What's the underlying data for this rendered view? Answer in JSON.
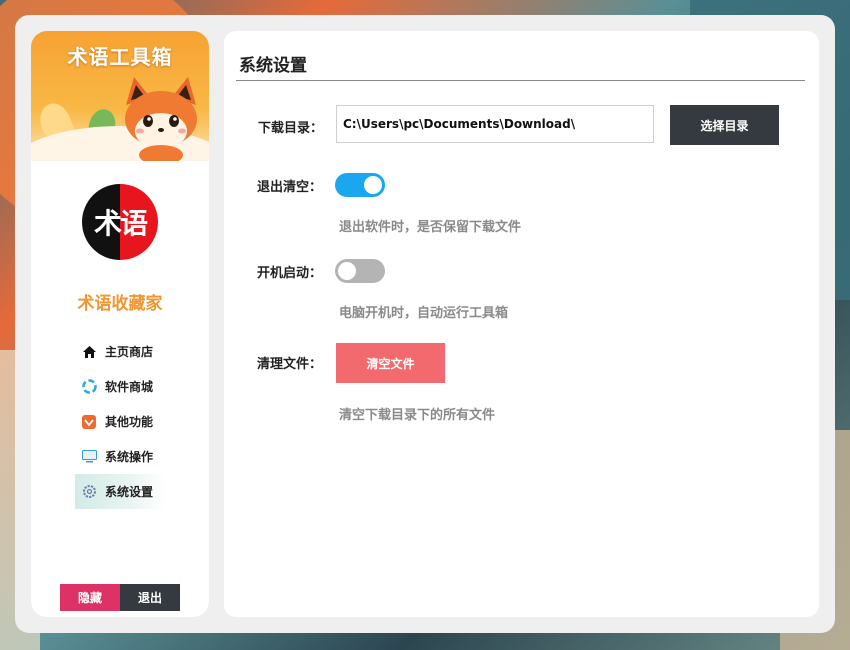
{
  "sidebar": {
    "banner_title": "术语工具箱",
    "logo_text": "术语",
    "app_name": "术语收藏家",
    "items": [
      {
        "label": "主页商店",
        "icon": "home-icon"
      },
      {
        "label": "软件商城",
        "icon": "store-icon"
      },
      {
        "label": "其他功能",
        "icon": "feature-icon"
      },
      {
        "label": "系统操作",
        "icon": "monitor-icon"
      },
      {
        "label": "系统设置",
        "icon": "gear-icon"
      }
    ],
    "hide_label": "隐藏",
    "exit_label": "退出"
  },
  "main": {
    "title": "系统设置",
    "download_dir": {
      "label": "下载目录：",
      "value": "C:\\Users\\pc\\Documents\\Download\\",
      "button": "选择目录"
    },
    "clear_on_exit": {
      "label": "退出清空：",
      "enabled": true,
      "hint": "退出软件时，是否保留下载文件"
    },
    "autostart": {
      "label": "开机启动：",
      "enabled": false,
      "hint": "电脑开机时，自动运行工具箱"
    },
    "clean_files": {
      "label": "清理文件：",
      "button": "清空文件",
      "hint": "清空下载目录下的所有文件"
    }
  },
  "colors": {
    "accent_orange": "#f29630",
    "toggle_on": "#1aa7f0",
    "toggle_off": "#b4b4b4",
    "clear_button": "#f2696e",
    "hide_button": "#dc3265",
    "dark_button": "#343a40"
  }
}
